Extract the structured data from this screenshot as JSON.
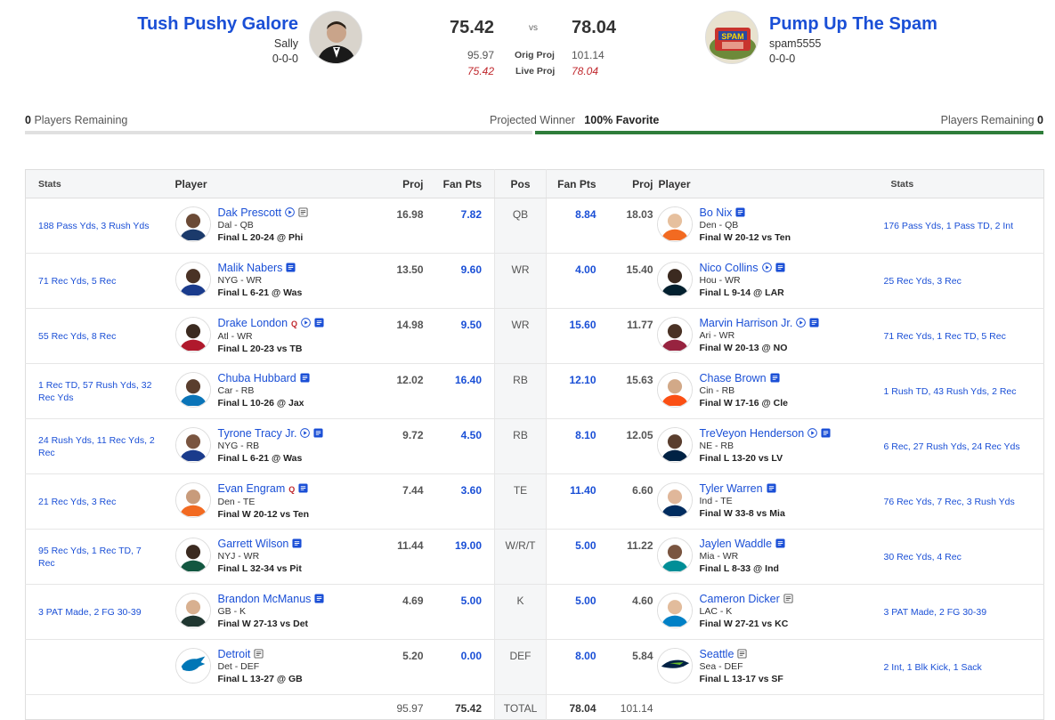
{
  "left_team": {
    "name": "Tush Pushy Galore",
    "owner": "Sally",
    "record": "0-0-0",
    "score": "75.42",
    "orig_proj": "95.97",
    "live_proj": "75.42",
    "players_remaining": "0",
    "players_remaining_label": "Players Remaining"
  },
  "right_team": {
    "name": "Pump Up The Spam",
    "owner": "spam5555",
    "record": "0-0-0",
    "score": "78.04",
    "orig_proj": "101.14",
    "live_proj": "78.04",
    "players_remaining": "0",
    "players_remaining_label": "Players Remaining",
    "avatar_text": "SPAM"
  },
  "vs": "vs",
  "labels": {
    "orig_proj": "Orig Proj",
    "live_proj": "Live Proj",
    "projected_winner": "Projected Winner",
    "favorite": "100% Favorite"
  },
  "colors": {
    "link": "#1a4fd6",
    "live": "#c0282d",
    "win_bar": "#2e7d3a",
    "lose_bar": "#e0e0e0"
  },
  "headers": {
    "stats": "Stats",
    "player": "Player",
    "proj": "Proj",
    "fan_pts": "Fan Pts",
    "pos": "Pos"
  },
  "rows": [
    {
      "pos": "QB",
      "left": {
        "stats": "188 Pass Yds, 3 Rush Yds",
        "name": "Dak Prescott",
        "team_pos": "Dal - QB",
        "game": "Final L 20-24 @ Phi",
        "proj": "16.98",
        "fp": "7.82",
        "q": "",
        "video": true,
        "note": "notes-icon"
      },
      "right": {
        "stats": "176 Pass Yds, 1 Pass TD, 2 Int",
        "name": "Bo Nix",
        "team_pos": "Den - QB",
        "game": "Final W 20-12 vs Ten",
        "proj": "18.03",
        "fp": "8.84",
        "q": "",
        "video": false,
        "note": "notes-new-icon"
      }
    },
    {
      "pos": "WR",
      "left": {
        "stats": "71 Rec Yds, 5 Rec",
        "name": "Malik Nabers",
        "team_pos": "NYG - WR",
        "game": "Final L 6-21 @ Was",
        "proj": "13.50",
        "fp": "9.60",
        "q": "",
        "video": false,
        "note": "notes-new-icon"
      },
      "right": {
        "stats": "25 Rec Yds, 3 Rec",
        "name": "Nico Collins",
        "team_pos": "Hou - WR",
        "game": "Final L 9-14 @ LAR",
        "proj": "15.40",
        "fp": "4.00",
        "q": "",
        "video": true,
        "note": "notes-new-icon"
      }
    },
    {
      "pos": "WR",
      "left": {
        "stats": "55 Rec Yds, 8 Rec",
        "name": "Drake London",
        "team_pos": "Atl - WR",
        "game": "Final L 20-23 vs TB",
        "proj": "14.98",
        "fp": "9.50",
        "q": "Q",
        "video": true,
        "note": "notes-new-icon"
      },
      "right": {
        "stats": "71 Rec Yds, 1 Rec TD, 5 Rec",
        "name": "Marvin Harrison Jr.",
        "team_pos": "Ari - WR",
        "game": "Final W 20-13 @ NO",
        "proj": "11.77",
        "fp": "15.60",
        "q": "",
        "video": true,
        "note": "notes-new-icon"
      }
    },
    {
      "pos": "RB",
      "left": {
        "stats": "1 Rec TD, 57 Rush Yds, 32 Rec Yds",
        "name": "Chuba Hubbard",
        "team_pos": "Car - RB",
        "game": "Final L 10-26 @ Jax",
        "proj": "12.02",
        "fp": "16.40",
        "q": "",
        "video": false,
        "note": "notes-new-icon"
      },
      "right": {
        "stats": "1 Rush TD, 43 Rush Yds, 2 Rec",
        "name": "Chase Brown",
        "team_pos": "Cin - RB",
        "game": "Final W 17-16 @ Cle",
        "proj": "15.63",
        "fp": "12.10",
        "q": "",
        "video": false,
        "note": "notes-new-icon"
      }
    },
    {
      "pos": "RB",
      "left": {
        "stats": "24 Rush Yds, 11 Rec Yds, 2 Rec",
        "name": "Tyrone Tracy Jr.",
        "team_pos": "NYG - RB",
        "game": "Final L 6-21 @ Was",
        "proj": "9.72",
        "fp": "4.50",
        "q": "",
        "video": true,
        "note": "notes-new-icon"
      },
      "right": {
        "stats": "6 Rec, 27 Rush Yds, 24 Rec Yds",
        "name": "TreVeyon Henderson",
        "team_pos": "NE - RB",
        "game": "Final L 13-20 vs LV",
        "proj": "12.05",
        "fp": "8.10",
        "q": "",
        "video": true,
        "note": "notes-new-icon"
      }
    },
    {
      "pos": "TE",
      "left": {
        "stats": "21 Rec Yds, 3 Rec",
        "name": "Evan Engram",
        "team_pos": "Den - TE",
        "game": "Final W 20-12 vs Ten",
        "proj": "7.44",
        "fp": "3.60",
        "q": "Q",
        "video": false,
        "note": "notes-new-icon"
      },
      "right": {
        "stats": "76 Rec Yds, 7 Rec, 3 Rush Yds",
        "name": "Tyler Warren",
        "team_pos": "Ind - TE",
        "game": "Final W 33-8 vs Mia",
        "proj": "6.60",
        "fp": "11.40",
        "q": "",
        "video": false,
        "note": "notes-new-icon"
      }
    },
    {
      "pos": "W/R/T",
      "left": {
        "stats": "95 Rec Yds, 1 Rec TD, 7 Rec",
        "name": "Garrett Wilson",
        "team_pos": "NYJ - WR",
        "game": "Final L 32-34 vs Pit",
        "proj": "11.44",
        "fp": "19.00",
        "q": "",
        "video": false,
        "note": "notes-new-icon"
      },
      "right": {
        "stats": "30 Rec Yds, 4 Rec",
        "name": "Jaylen Waddle",
        "team_pos": "Mia - WR",
        "game": "Final L 8-33 @ Ind",
        "proj": "11.22",
        "fp": "5.00",
        "q": "",
        "video": false,
        "note": "notes-new-icon"
      }
    },
    {
      "pos": "K",
      "left": {
        "stats": "3 PAT Made, 2 FG 30-39",
        "name": "Brandon McManus",
        "team_pos": "GB - K",
        "game": "Final W 27-13 vs Det",
        "proj": "4.69",
        "fp": "5.00",
        "q": "",
        "video": false,
        "note": "notes-new-icon"
      },
      "right": {
        "stats": "3 PAT Made, 2 FG 30-39",
        "name": "Cameron Dicker",
        "team_pos": "LAC - K",
        "game": "Final W 27-21 vs KC",
        "proj": "4.60",
        "fp": "5.00",
        "q": "",
        "video": false,
        "note": "notes-icon"
      }
    },
    {
      "pos": "DEF",
      "left": {
        "stats": "",
        "name": "Detroit",
        "team_pos": "Det - DEF",
        "game": "Final L 13-27 @ GB",
        "proj": "5.20",
        "fp": "0.00",
        "q": "",
        "video": false,
        "note": "notes-icon"
      },
      "right": {
        "stats": "2 Int, 1 Blk Kick, 1 Sack",
        "name": "Seattle",
        "team_pos": "Sea - DEF",
        "game": "Final L 13-17 vs SF",
        "proj": "5.84",
        "fp": "8.00",
        "q": "",
        "video": false,
        "note": "notes-icon"
      }
    }
  ],
  "totals": {
    "label": "TOTAL",
    "left_proj": "95.97",
    "left_fp": "75.42",
    "right_fp": "78.04",
    "right_proj": "101.14"
  }
}
